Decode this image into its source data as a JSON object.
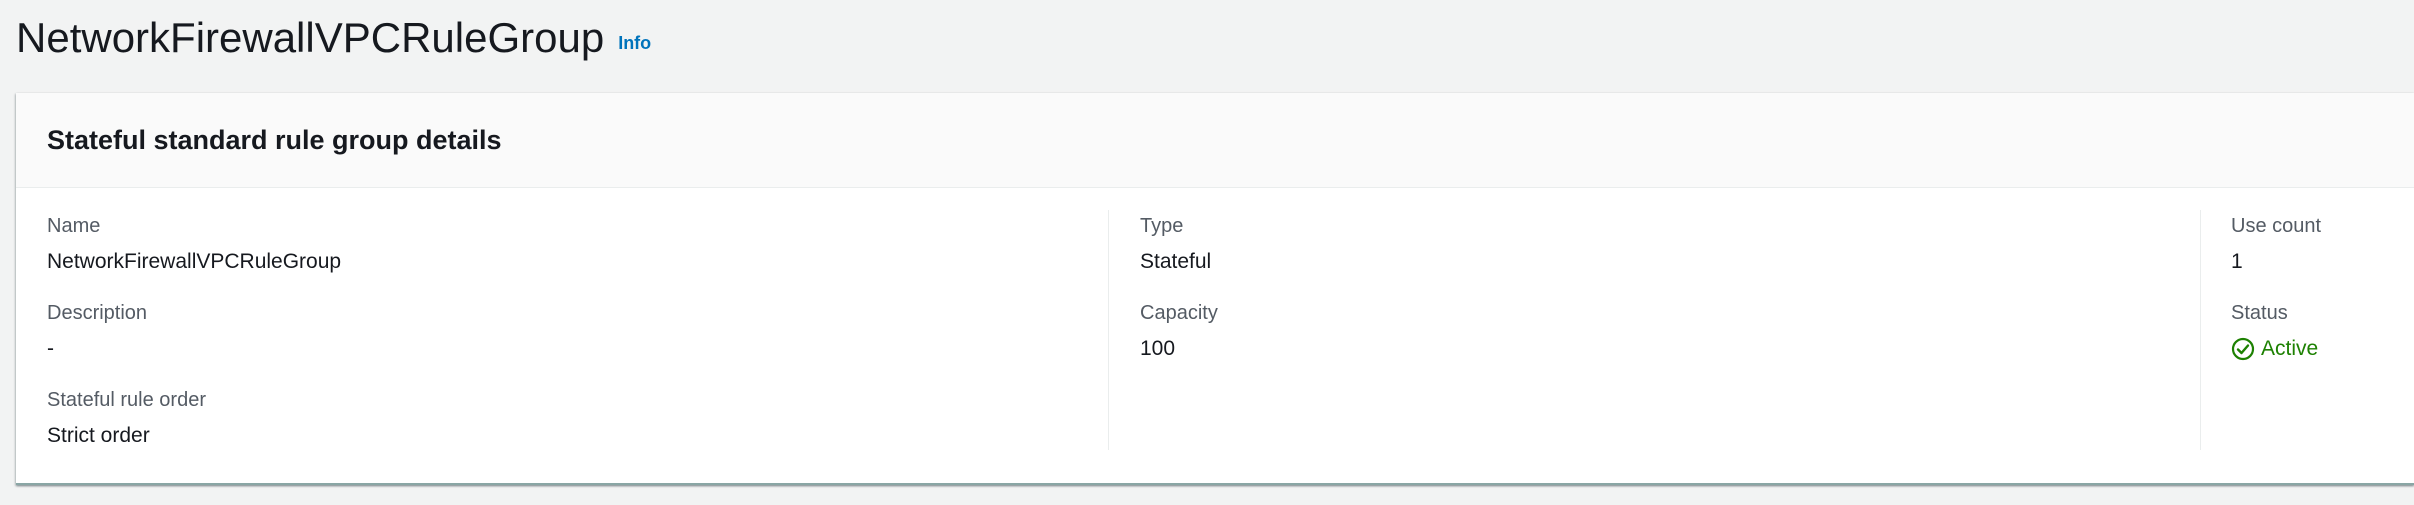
{
  "page": {
    "title": "NetworkFirewallVPCRuleGroup",
    "info_link": "Info"
  },
  "details": {
    "heading": "Stateful standard rule group details",
    "col1": {
      "name_label": "Name",
      "name_value": "NetworkFirewallVPCRuleGroup",
      "description_label": "Description",
      "description_value": "-",
      "rule_order_label": "Stateful rule order",
      "rule_order_value": "Strict order"
    },
    "col2": {
      "type_label": "Type",
      "type_value": "Stateful",
      "capacity_label": "Capacity",
      "capacity_value": "100"
    },
    "col3": {
      "use_count_label": "Use count",
      "use_count_value": "1",
      "status_label": "Status",
      "status_value": "Active",
      "status_icon": "check-circle-icon"
    }
  },
  "colors": {
    "link": "#0073bb",
    "success": "#1d8102",
    "background": "#f2f3f3"
  }
}
